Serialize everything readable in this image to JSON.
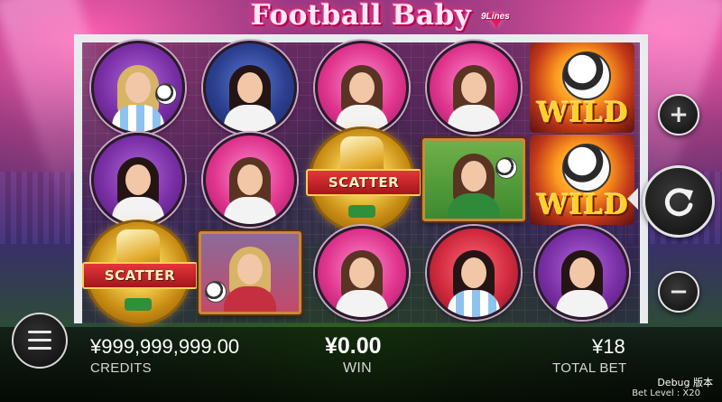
{
  "game": {
    "title": "Football Baby",
    "title_lines": "9Lines"
  },
  "reels": [
    [
      "player-purple",
      "player-purple",
      "scatter"
    ],
    [
      "player-navy",
      "player-pink",
      "player-photo-blonde"
    ],
    [
      "player-pink",
      "scatter",
      "player-pink"
    ],
    [
      "player-pink",
      "player-photo-green",
      "player-red"
    ],
    [
      "wild",
      "wild",
      "player-purple"
    ]
  ],
  "symbols": {
    "scatter_label": "SCATTER",
    "wild_label": "WILD"
  },
  "controls": {
    "plus_icon": "+",
    "minus_icon": "−",
    "spin_icon": "refresh-icon",
    "menu_icon": "hamburger-icon"
  },
  "hud": {
    "credits_value": "¥999,999,999.00",
    "credits_label": "CREDITS",
    "win_value": "¥0.00",
    "win_label": "WIN",
    "total_bet_value": "¥18",
    "total_bet_label": "TOTAL BET",
    "debug": "Debug 版本",
    "bet_level": "Bet Level : X20"
  },
  "colors": {
    "accent_pink": "#e0195f",
    "gold": "#f1c94a",
    "goal_post": "#e9ecef"
  }
}
